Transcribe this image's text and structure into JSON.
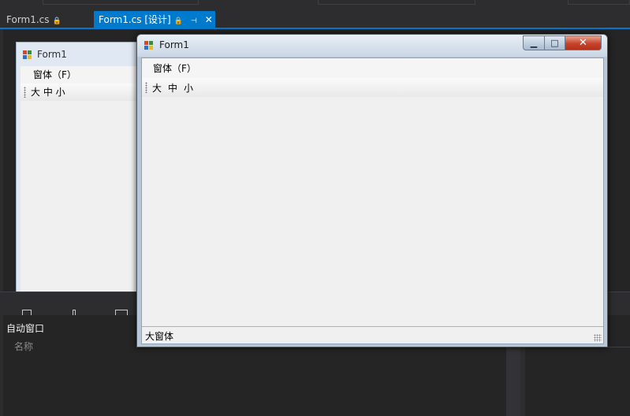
{
  "ide": {
    "tabs": [
      {
        "label": "Form1.cs",
        "pin": "🔒"
      },
      {
        "label": "Form1.cs [设计]",
        "pin": "🔒",
        "dock": "⊣",
        "close": "✕"
      }
    ]
  },
  "design_form": {
    "title": "Form1",
    "menu_item": "窗体（F）",
    "toolbar_text": "大 中 小"
  },
  "app_window": {
    "title": "Form1",
    "controls": {
      "minimize": "▁",
      "maximize": "□",
      "close": "✕"
    },
    "menu_item": "窗体（F）",
    "toolbar_buttons": [
      "大",
      "中",
      "小"
    ],
    "status_text": "大窗体"
  },
  "auto_window": {
    "title": "自动窗口",
    "column_name": "名称"
  },
  "colors": {
    "ide_background": "#2d2d30",
    "accent": "#007acc",
    "form_client": "#f0f0f0",
    "close_button": "#c7442b"
  }
}
